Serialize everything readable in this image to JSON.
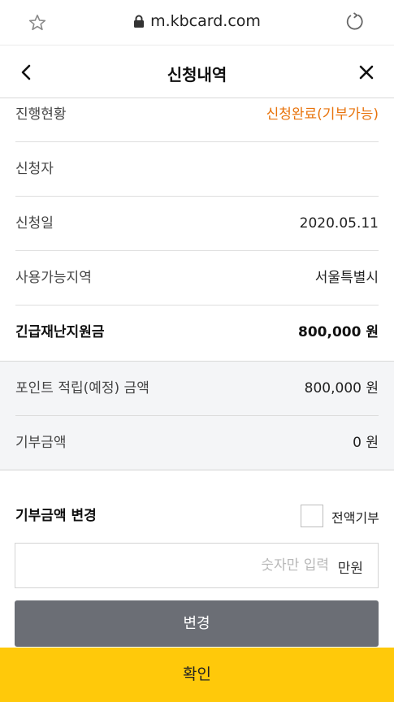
{
  "browser": {
    "url": "m.kbcard.com"
  },
  "header": {
    "title": "신청내역"
  },
  "details": [
    {
      "label": "진행현황",
      "value": "신청완료(기부가능)"
    },
    {
      "label": "신청자",
      "value": ""
    },
    {
      "label": "신청일",
      "value": "2020.05.11"
    },
    {
      "label": "사용가능지역",
      "value": "서울특별시"
    },
    {
      "label": "긴급재난지원금",
      "value": "800,000 원"
    }
  ],
  "summary": [
    {
      "label": "포인트 적립(예정) 금액",
      "value": "800,000 원"
    },
    {
      "label": "기부금액",
      "value": "0 원"
    }
  ],
  "donation": {
    "title": "기부금액 변경",
    "full_donation_label": "전액기부",
    "full_donation_checked": false,
    "amount_placeholder": "숫자만 입력",
    "amount_value": "",
    "unit": "만원",
    "change_label": "변경"
  },
  "footer": {
    "confirm_label": "확인"
  },
  "colors": {
    "status_accent": "#e8730c",
    "confirm_button": "#ffc90a",
    "change_button": "#6b6e75"
  }
}
